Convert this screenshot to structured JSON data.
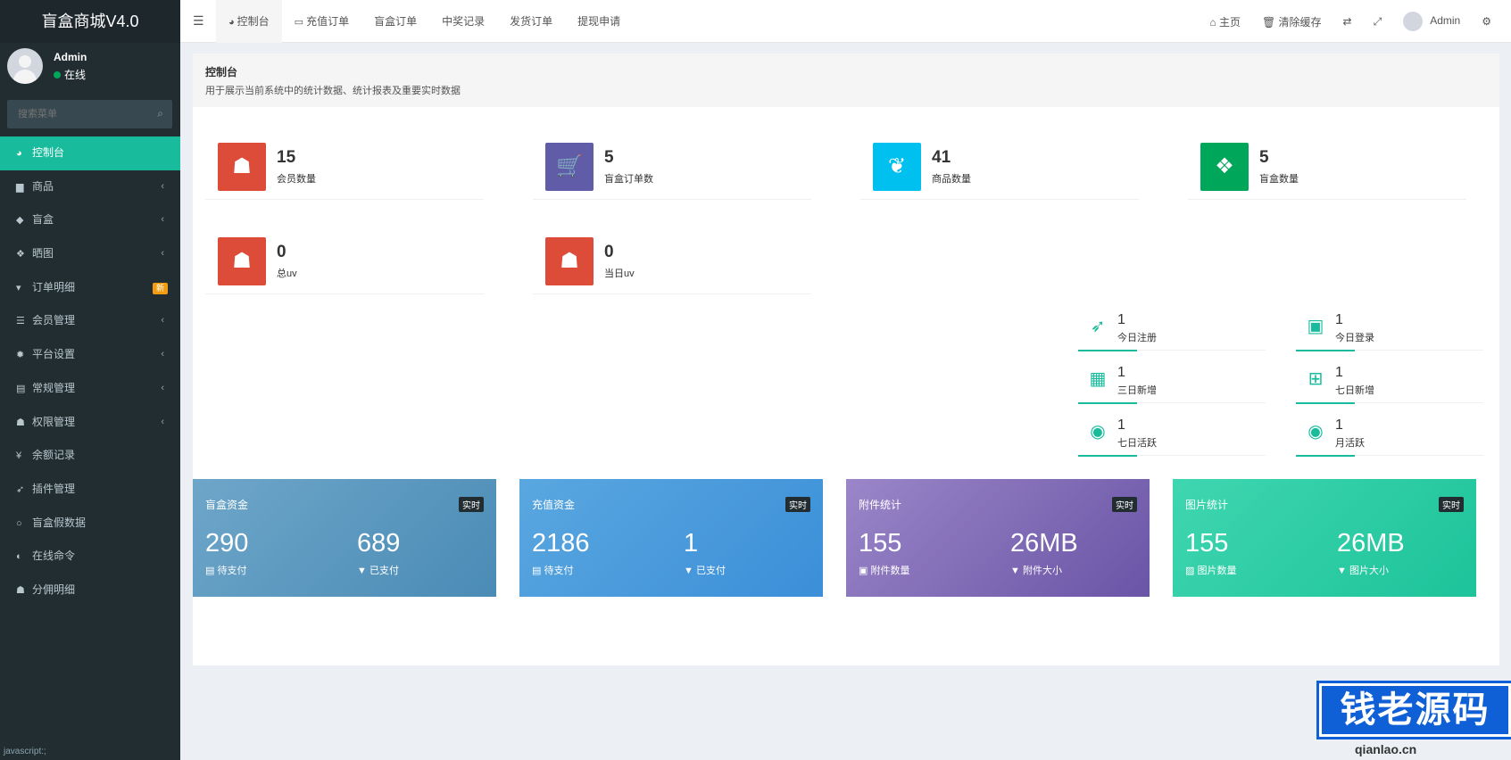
{
  "app": {
    "title": "盲盒商城V4.0"
  },
  "user": {
    "name": "Admin",
    "status": "在线"
  },
  "search": {
    "placeholder": "搜索菜单"
  },
  "sidebar": {
    "items": [
      {
        "label": "控制台",
        "icon": "dashboard-icon",
        "glyph": "◕",
        "active": true,
        "arrow": false
      },
      {
        "label": "商品",
        "icon": "bag-icon",
        "glyph": "▆",
        "arrow": true
      },
      {
        "label": "盲盒",
        "icon": "cube-icon",
        "glyph": "◆",
        "arrow": true
      },
      {
        "label": "晒图",
        "icon": "dropbox-icon",
        "glyph": "❖",
        "arrow": true
      },
      {
        "label": "订单明细",
        "icon": "cart-icon",
        "glyph": "▾",
        "badge": "新"
      },
      {
        "label": "会员管理",
        "icon": "list-icon",
        "glyph": "☰",
        "arrow": true
      },
      {
        "label": "平台设置",
        "icon": "gear-icon",
        "glyph": "✹",
        "arrow": true
      },
      {
        "label": "常规管理",
        "icon": "database-icon",
        "glyph": "▤",
        "arrow": true
      },
      {
        "label": "权限管理",
        "icon": "users-icon",
        "glyph": "☗",
        "arrow": true
      },
      {
        "label": "余额记录",
        "icon": "yen-icon",
        "glyph": "¥"
      },
      {
        "label": "插件管理",
        "icon": "rocket-icon",
        "glyph": "➶"
      },
      {
        "label": "盲盒假数据",
        "icon": "circle-icon",
        "glyph": "○"
      },
      {
        "label": "在线命令",
        "icon": "adjust-icon",
        "glyph": "◐"
      },
      {
        "label": "分佣明细",
        "icon": "users-icon",
        "glyph": "☗"
      }
    ],
    "footer": "javascript:;"
  },
  "navbar": {
    "tabs": [
      {
        "label": "控制台",
        "icon": "dashboard-icon",
        "glyph": "◕",
        "active": true
      },
      {
        "label": "充值订单",
        "icon": "battery-icon",
        "glyph": "▭"
      },
      {
        "label": "盲盒订单"
      },
      {
        "label": "中奖记录"
      },
      {
        "label": "发货订单"
      },
      {
        "label": "提现申请"
      }
    ],
    "right": {
      "home": "主页",
      "clear_cache": "清除缓存",
      "admin": "Admin"
    }
  },
  "page": {
    "title": "控制台",
    "subtitle": "用于展示当前系统中的统计数据、统计报表及重要实时数据"
  },
  "stats": [
    {
      "value": "15",
      "label": "会员数量",
      "color": "#dd4b39",
      "icon": "users-icon",
      "glyph": "☗"
    },
    {
      "value": "5",
      "label": "盲盒订单数",
      "color": "#605ca8",
      "icon": "cart-icon",
      "glyph": "🛒"
    },
    {
      "value": "41",
      "label": "商品数量",
      "color": "#00c0ef",
      "icon": "leaf-icon",
      "glyph": "❦"
    },
    {
      "value": "5",
      "label": "盲盒数量",
      "color": "#00a65a",
      "icon": "dropbox-icon",
      "glyph": "❖"
    },
    {
      "value": "0",
      "label": "总uv",
      "color": "#dd4b39",
      "icon": "users-icon",
      "glyph": "☗"
    },
    {
      "value": "0",
      "label": "当日uv",
      "color": "#dd4b39",
      "icon": "users-icon",
      "glyph": "☗"
    }
  ],
  "mini_stats": [
    {
      "value": "1",
      "label": "今日注册",
      "icon": "rocket-icon",
      "glyph": "➶"
    },
    {
      "value": "1",
      "label": "今日登录",
      "icon": "id-card-icon",
      "glyph": "▣"
    },
    {
      "value": "1",
      "label": "三日新增",
      "icon": "calendar-icon",
      "glyph": "▦"
    },
    {
      "value": "1",
      "label": "七日新增",
      "icon": "calendar-plus-icon",
      "glyph": "⊞"
    },
    {
      "value": "1",
      "label": "七日活跃",
      "icon": "user-circle-icon",
      "glyph": "◉"
    },
    {
      "value": "1",
      "label": "月活跃",
      "icon": "user-circle-icon",
      "glyph": "◉"
    }
  ],
  "cards": [
    {
      "title": "盲盒资金",
      "tag": "实时",
      "v1": "290",
      "l1": "▤ 待支付",
      "v2": "689",
      "l2": "▼ 已支付",
      "gradient": [
        "#6ea6c9",
        "#4a8bb5"
      ]
    },
    {
      "title": "充值资金",
      "tag": "实时",
      "v1": "2186",
      "l1": "▤ 待支付",
      "v2": "1",
      "l2": "▼ 已支付",
      "gradient": [
        "#5aa7e0",
        "#3b8fd8"
      ]
    },
    {
      "title": "附件统计",
      "tag": "实时",
      "v1": "155",
      "l1": "▣ 附件数量",
      "v2": "26MB",
      "l2": "▼ 附件大小",
      "gradient": [
        "#9a86c8",
        "#6a54a6"
      ]
    },
    {
      "title": "图片统计",
      "tag": "实时",
      "v1": "155",
      "l1": "▨ 图片数量",
      "v2": "26MB",
      "l2": "▼ 图片大小",
      "gradient": [
        "#3fd6b0",
        "#1dc39a"
      ]
    }
  ],
  "watermark": {
    "text": "钱老源码",
    "url": "qianlao.cn"
  }
}
